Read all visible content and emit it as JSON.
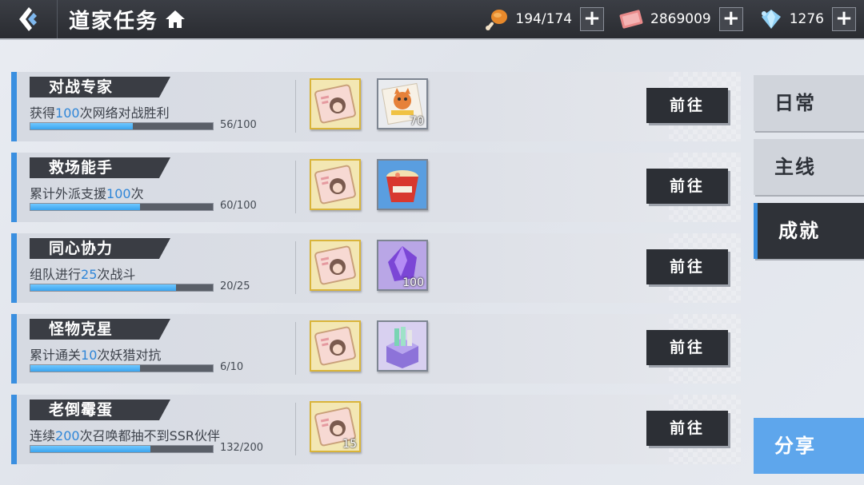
{
  "header": {
    "title": "道家任务",
    "resources": [
      {
        "icon": "drumstick-icon",
        "value": "194/174"
      },
      {
        "icon": "ticket-icon",
        "value": "2869009"
      },
      {
        "icon": "crystal-icon",
        "value": "1276"
      }
    ],
    "plus_label": "+"
  },
  "tasks": [
    {
      "name": "对战专家",
      "desc_pre": "获得",
      "desc_num": "100",
      "desc_post": "次网络对战胜利",
      "progress": "56/100",
      "fraction": 0.56,
      "rewards": [
        {
          "icon": "character-card-icon",
          "qty": ""
        },
        {
          "icon": "cat-card-icon",
          "qty": "70"
        }
      ]
    },
    {
      "name": "救场能手",
      "desc_pre": "累计外派支援",
      "desc_num": "100",
      "desc_post": "次",
      "progress": "60/100",
      "fraction": 0.6,
      "rewards": [
        {
          "icon": "character-card-icon",
          "qty": ""
        },
        {
          "icon": "noodle-cup-icon",
          "qty": ""
        }
      ]
    },
    {
      "name": "同心协力",
      "desc_pre": "组队进行",
      "desc_num": "25",
      "desc_post": "次战斗",
      "progress": "20/25",
      "fraction": 0.8,
      "rewards": [
        {
          "icon": "character-card-icon",
          "qty": ""
        },
        {
          "icon": "purple-crystal-icon",
          "qty": "100"
        }
      ]
    },
    {
      "name": "怪物克星",
      "desc_pre": "累计通关",
      "desc_num": "10",
      "desc_post": "次妖猎对抗",
      "progress": "6/10",
      "fraction": 0.6,
      "rewards": [
        {
          "icon": "character-card-icon",
          "qty": ""
        },
        {
          "icon": "gift-box-icon",
          "qty": ""
        }
      ]
    },
    {
      "name": "老倒霉蛋",
      "desc_pre": "连续",
      "desc_num": "200",
      "desc_post": "次召唤都抽不到SSR伙伴",
      "progress": "132/200",
      "fraction": 0.66,
      "rewards": [
        {
          "icon": "character-card-icon",
          "qty": "15"
        }
      ]
    }
  ],
  "go_label": "前往",
  "tabs": [
    {
      "label": "日常",
      "active": false
    },
    {
      "label": "主线",
      "active": false
    },
    {
      "label": "成就",
      "active": true
    }
  ],
  "share_label": "分享",
  "colors": {
    "accent": "#3a8fe0",
    "progress": "#3aa4ee",
    "dark": "#2c2f35"
  }
}
